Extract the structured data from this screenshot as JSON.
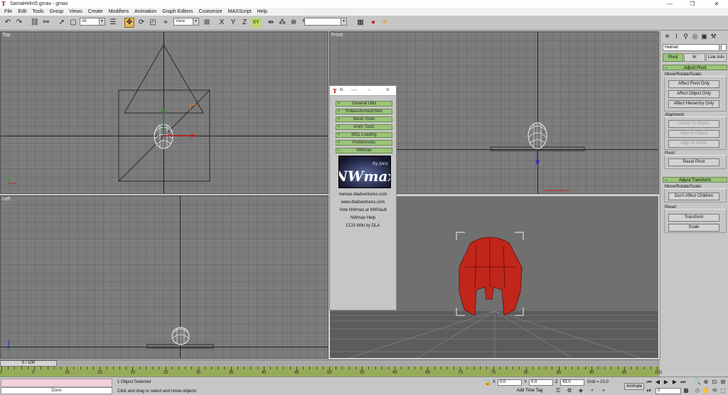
{
  "window": {
    "title": "SarnaHelm5.gmax - gmax",
    "minimize_glyph": "—",
    "maximize_glyph": "❐",
    "close_glyph": "✕"
  },
  "menubar": {
    "items": [
      "File",
      "Edit",
      "Tools",
      "Group",
      "Views",
      "Create",
      "Modifiers",
      "Animation",
      "Graph Editors",
      "Customize",
      "MAXScript",
      "Help"
    ]
  },
  "toolbar": {
    "selection_filter": "All",
    "reference_coord": "View",
    "named_selection": "",
    "xy_constraint": "XY"
  },
  "viewports": {
    "top_label": "Top",
    "front_label": "Front",
    "left_label": "Left"
  },
  "command_panel": {
    "object_name": "Helmet",
    "tabs": [
      "Pivot",
      "IK",
      "Link Info"
    ],
    "active_tab": "Pivot",
    "adjust_pivot": {
      "title": "Adjust Pivot",
      "move_group_label": "Move/Rotate/Scale:",
      "buttons": [
        "Affect Pivot Only",
        "Affect Object Only",
        "Affect Hierarchy Only"
      ],
      "alignment_label": "Alignment:",
      "alignment_buttons": [
        "Center to Object",
        "Align to Object",
        "Align to World"
      ],
      "pivot_label": "Pivot:",
      "reset_pivot": "Reset Pivot"
    },
    "adjust_transform": {
      "title": "Adjust Transform",
      "move_group_label": "Move/Rotate/Scale:",
      "dont_affect_children": "Don't Affect Children",
      "reset_label": "Reset:",
      "transform": "Transform",
      "scale": "Scale"
    }
  },
  "nwmax_panel": {
    "title": "N",
    "rollouts": [
      "General Utils",
      "Robes/Armour/Skin",
      "Mesh Tools",
      "Anim Tools",
      "MDL Loading",
      "Preferences",
      "NWmax"
    ],
    "logo_text": "NWmax",
    "logo_byline": "by Joco",
    "links": [
      "nwmax.dladventures.com",
      "www.dladventures.com",
      "Vote NWmax at NWVault",
      "NWmax Help",
      "CCG Wiki by DLA"
    ]
  },
  "timeline": {
    "frame_indicator": "0 / 100",
    "tick_labels": [
      "0",
      "5",
      "10",
      "15",
      "20",
      "25",
      "30",
      "35",
      "40",
      "45",
      "50",
      "55",
      "60",
      "65",
      "70",
      "75",
      "80",
      "85",
      "90",
      "95",
      "100"
    ]
  },
  "status": {
    "done_label": "Done",
    "selection_status": "1 Object Selected",
    "prompt": "Click and drag to select and move objects",
    "x_label": "X",
    "x_value": "0.0",
    "y_label": "Y",
    "y_value": "0.0",
    "z_label": "Z",
    "z_value": "43.0",
    "grid": "Grid = 10.0",
    "add_time_tag": "Add Time Tag",
    "animate": "Animate",
    "frame_field": "0"
  },
  "colors": {
    "helmet": "#c0261a",
    "rollout_green": "#9cc47a",
    "trackbar_green": "#97ac5a",
    "viewport_gray": "#7c7c7c",
    "active_tool": "#e3b75a"
  }
}
